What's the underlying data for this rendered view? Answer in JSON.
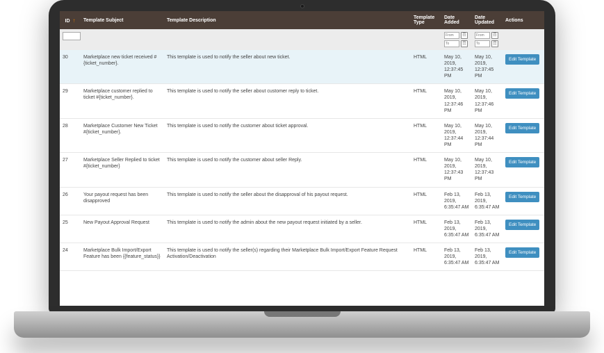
{
  "header": {
    "id": "ID",
    "subject": "Template Subject",
    "description": "Template Description",
    "type": "Template Type",
    "added": "Date Added",
    "updated": "Date Updated",
    "actions": "Actions"
  },
  "filters": {
    "id_placeholder": "",
    "date_from": "From",
    "date_to": "To"
  },
  "action_label": "Edit Template",
  "rows": [
    {
      "id": "30",
      "subject": "Marketplace new ticket received #{ticket_number}.",
      "description": "This template is used to notify the seller about new ticket.",
      "type": "HTML",
      "added": "May 10, 2019, 12:37:45 PM",
      "updated": "May 10, 2019, 12:37:45 PM"
    },
    {
      "id": "29",
      "subject": "Marketplace customer replied to ticket #{ticket_number}.",
      "description": "This template is used to notify the seller about customer reply to ticket.",
      "type": "HTML",
      "added": "May 10, 2019, 12:37:46 PM",
      "updated": "May 10, 2019, 12:37:46 PM"
    },
    {
      "id": "28",
      "subject": "Marketplace Customer New Ticket #{ticket_number}.",
      "description": "This template is used to notify the customer about ticket approval.",
      "type": "HTML",
      "added": "May 10, 2019, 12:37:44 PM",
      "updated": "May 10, 2019, 12:37:44 PM"
    },
    {
      "id": "27",
      "subject": "Marketplace Seller Replied to ticket #{ticket_number}",
      "description": "This template is used to notify the customer about seller Reply.",
      "type": "HTML",
      "added": "May 10, 2019, 12:37:43 PM",
      "updated": "May 10, 2019, 12:37:43 PM"
    },
    {
      "id": "26",
      "subject": "Your payout request has been disapproved",
      "description": "This template is used to notify the seller about the disapproval of his payout request.",
      "type": "HTML",
      "added": "Feb 13, 2019, 6:35:47 AM",
      "updated": "Feb 13, 2019, 6:35:47 AM"
    },
    {
      "id": "25",
      "subject": "New Payout Approval Request",
      "description": "This template is used to notify the admin about the new payout request initiated by a seller.",
      "type": "HTML",
      "added": "Feb 13, 2019, 6:35:47 AM",
      "updated": "Feb 13, 2019, 6:35:47 AM"
    },
    {
      "id": "24",
      "subject": "Marketplace Bulk Import/Export Feature has been {{feature_status}}",
      "description": "This template is used to notify the seller(s) regarding their Marketplace Bulk Import/Export Feature Request Activation/Deactivation",
      "type": "HTML",
      "added": "Feb 13, 2019, 6:35:47 AM",
      "updated": "Feb 13, 2019, 6:35:47 AM"
    }
  ]
}
